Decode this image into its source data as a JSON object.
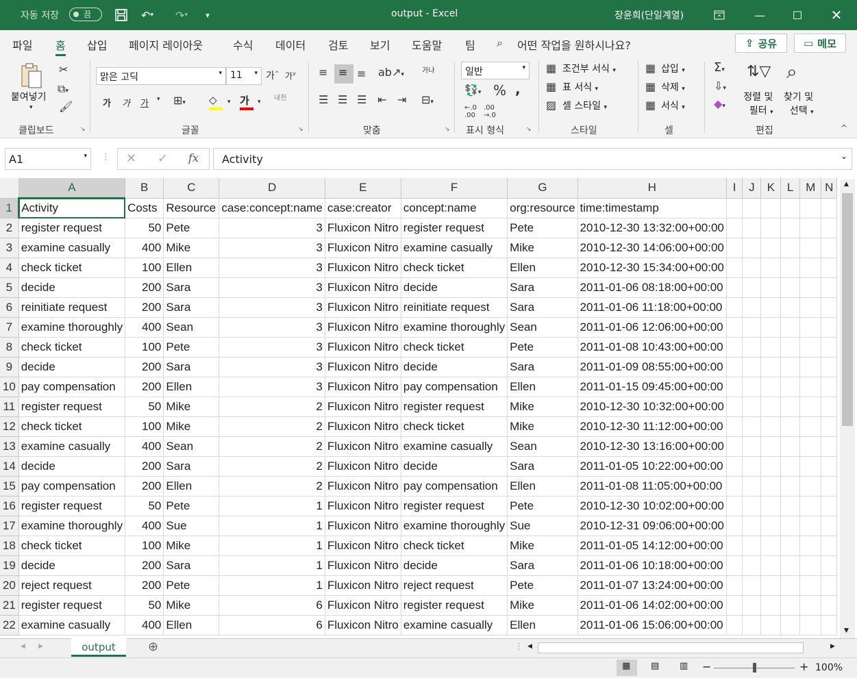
{
  "titlebar": {
    "autosave_label": "자동 저장",
    "autosave_state": "끔",
    "title": "output  -  Excel",
    "user": "장윤희(단일계열)"
  },
  "tabs": [
    "파일",
    "홈",
    "삽입",
    "페이지 레이아웃",
    "수식",
    "데이터",
    "검토",
    "보기",
    "도움말",
    "팀"
  ],
  "tell_me": "어떤 작업을 원하시나요?",
  "share_label": "공유",
  "memo_label": "메모",
  "ribbon": {
    "clipboard": {
      "paste": "붙여넣기",
      "group": "클립보드"
    },
    "font": {
      "name": "맑은 고딕",
      "size": "11",
      "group": "글꼴",
      "bold": "가",
      "italic": "가",
      "underline": "가",
      "color_letter": "가",
      "phonetic": "내천"
    },
    "align": {
      "group": "맞춤",
      "wrap": "가나"
    },
    "number": {
      "format": "일반",
      "group": "표시 형식"
    },
    "styles": {
      "cond": "조건부 서식",
      "table": "표 서식",
      "cell": "셀 스타일",
      "group": "스타일"
    },
    "cells": {
      "insert": "삽입",
      "delete": "삭제",
      "format": "서식",
      "group": "셀"
    },
    "edit": {
      "sort": "정렬 및",
      "sort2": "필터",
      "find": "찾기 및",
      "find2": "선택",
      "group": "편집"
    }
  },
  "formula_bar": {
    "name_box": "A1",
    "fx": "fx",
    "value": "Activity"
  },
  "columns": [
    "A",
    "B",
    "C",
    "D",
    "E",
    "F",
    "G",
    "H",
    "I",
    "J",
    "K",
    "L",
    "M",
    "N"
  ],
  "rows": [
    [
      "Activity",
      "Costs",
      "Resource",
      "case:concept:name",
      "case:creator",
      "concept:name",
      "org:resource",
      "time:timestamp"
    ],
    [
      "register request",
      "50",
      "Pete",
      "3",
      "Fluxicon Nitro",
      "register request",
      "Pete",
      "2010-12-30 13:32:00+00:00"
    ],
    [
      "examine casually",
      "400",
      "Mike",
      "3",
      "Fluxicon Nitro",
      "examine casually",
      "Mike",
      "2010-12-30 14:06:00+00:00"
    ],
    [
      "check ticket",
      "100",
      "Ellen",
      "3",
      "Fluxicon Nitro",
      "check ticket",
      "Ellen",
      "2010-12-30 15:34:00+00:00"
    ],
    [
      "decide",
      "200",
      "Sara",
      "3",
      "Fluxicon Nitro",
      "decide",
      "Sara",
      "2011-01-06 08:18:00+00:00"
    ],
    [
      "reinitiate request",
      "200",
      "Sara",
      "3",
      "Fluxicon Nitro",
      "reinitiate request",
      "Sara",
      "2011-01-06 11:18:00+00:00"
    ],
    [
      "examine thoroughly",
      "400",
      "Sean",
      "3",
      "Fluxicon Nitro",
      "examine thoroughly",
      "Sean",
      "2011-01-06 12:06:00+00:00"
    ],
    [
      "check ticket",
      "100",
      "Pete",
      "3",
      "Fluxicon Nitro",
      "check ticket",
      "Pete",
      "2011-01-08 10:43:00+00:00"
    ],
    [
      "decide",
      "200",
      "Sara",
      "3",
      "Fluxicon Nitro",
      "decide",
      "Sara",
      "2011-01-09 08:55:00+00:00"
    ],
    [
      "pay compensation",
      "200",
      "Ellen",
      "3",
      "Fluxicon Nitro",
      "pay compensation",
      "Ellen",
      "2011-01-15 09:45:00+00:00"
    ],
    [
      "register request",
      "50",
      "Mike",
      "2",
      "Fluxicon Nitro",
      "register request",
      "Mike",
      "2010-12-30 10:32:00+00:00"
    ],
    [
      "check ticket",
      "100",
      "Mike",
      "2",
      "Fluxicon Nitro",
      "check ticket",
      "Mike",
      "2010-12-30 11:12:00+00:00"
    ],
    [
      "examine casually",
      "400",
      "Sean",
      "2",
      "Fluxicon Nitro",
      "examine casually",
      "Sean",
      "2010-12-30 13:16:00+00:00"
    ],
    [
      "decide",
      "200",
      "Sara",
      "2",
      "Fluxicon Nitro",
      "decide",
      "Sara",
      "2011-01-05 10:22:00+00:00"
    ],
    [
      "pay compensation",
      "200",
      "Ellen",
      "2",
      "Fluxicon Nitro",
      "pay compensation",
      "Ellen",
      "2011-01-08 11:05:00+00:00"
    ],
    [
      "register request",
      "50",
      "Pete",
      "1",
      "Fluxicon Nitro",
      "register request",
      "Pete",
      "2010-12-30 10:02:00+00:00"
    ],
    [
      "examine thoroughly",
      "400",
      "Sue",
      "1",
      "Fluxicon Nitro",
      "examine thoroughly",
      "Sue",
      "2010-12-31 09:06:00+00:00"
    ],
    [
      "check ticket",
      "100",
      "Mike",
      "1",
      "Fluxicon Nitro",
      "check ticket",
      "Mike",
      "2011-01-05 14:12:00+00:00"
    ],
    [
      "decide",
      "200",
      "Sara",
      "1",
      "Fluxicon Nitro",
      "decide",
      "Sara",
      "2011-01-06 10:18:00+00:00"
    ],
    [
      "reject request",
      "200",
      "Pete",
      "1",
      "Fluxicon Nitro",
      "reject request",
      "Pete",
      "2011-01-07 13:24:00+00:00"
    ],
    [
      "register request",
      "50",
      "Mike",
      "6",
      "Fluxicon Nitro",
      "register request",
      "Mike",
      "2011-01-06 14:02:00+00:00"
    ],
    [
      "examine casually",
      "400",
      "Ellen",
      "6",
      "Fluxicon Nitro",
      "examine casually",
      "Ellen",
      "2011-01-06 15:06:00+00:00"
    ]
  ],
  "sheet_tab": "output",
  "zoom": "100%",
  "colors": {
    "accent": "#217346"
  }
}
